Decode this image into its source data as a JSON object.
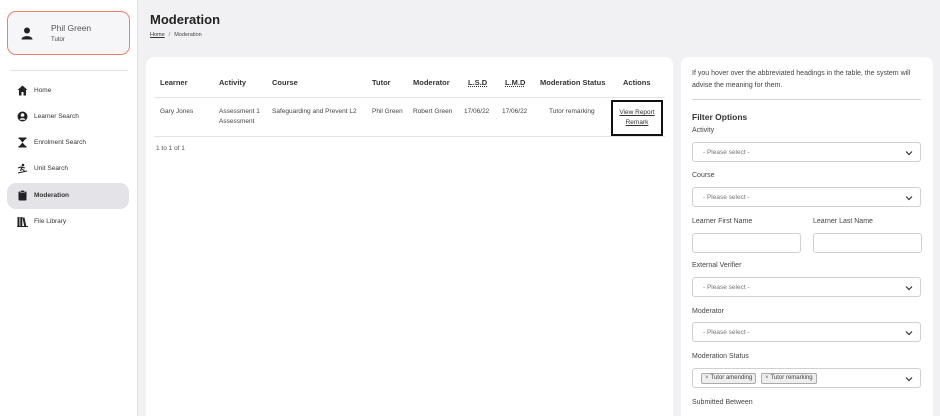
{
  "user": {
    "name": "Phil Green",
    "role": "Tutor"
  },
  "nav": [
    {
      "label": "Home",
      "icon": "home-icon"
    },
    {
      "label": "Learner Search",
      "icon": "person-icon"
    },
    {
      "label": "Enrolment Search",
      "icon": "hourglass-icon"
    },
    {
      "label": "Unit Search",
      "icon": "unit-icon"
    },
    {
      "label": "Moderation",
      "icon": "clipboard-icon",
      "active": true
    },
    {
      "label": "File Library",
      "icon": "library-icon"
    }
  ],
  "page": {
    "title": "Moderation"
  },
  "breadcrumb": {
    "home": "Home",
    "separator": "/",
    "current": "Moderation"
  },
  "table": {
    "headers": {
      "learner": "Learner",
      "activity": "Activity",
      "course": "Course",
      "tutor": "Tutor",
      "moderator": "Moderator",
      "lsd": "L.S.D",
      "lmd": "L.M.D",
      "status": "Moderation Status",
      "actions": "Actions"
    },
    "rows": [
      {
        "learner": "Gary Jones",
        "activity_line1": "Assessment 1",
        "activity_line2": "Assessment",
        "course": "Safeguarding and Prevent L2",
        "tutor": "Phil Green",
        "moderator": "Robert Green",
        "lsd": "17/06/22",
        "lmd": "17/06/22",
        "status": "Tutor remarking",
        "action_view": "View Report",
        "action_remark": "Remark"
      }
    ],
    "pagination": "1 to 1 of 1"
  },
  "filters": {
    "hint": "If you hover over the abbreviated headings in the table, the system will advise the meaning for them.",
    "title": "Filter Options",
    "activity_label": "Activity",
    "activity_value": "- Please select -",
    "course_label": "Course",
    "course_value": "- Please select -",
    "first_name_label": "Learner First Name",
    "last_name_label": "Learner Last Name",
    "ev_label": "External Verifier",
    "ev_value": "- Please select -",
    "moderator_label": "Moderator",
    "moderator_value": "- Please select -",
    "status_label": "Moderation Status",
    "status_chips": [
      "Tutor amending",
      "Tutor remarking"
    ],
    "submitted_label": "Submitted Between"
  },
  "colors": {
    "accent_border": "#e8826f",
    "active_nav": "#e3e3e8",
    "background": "#f1f1f3"
  }
}
